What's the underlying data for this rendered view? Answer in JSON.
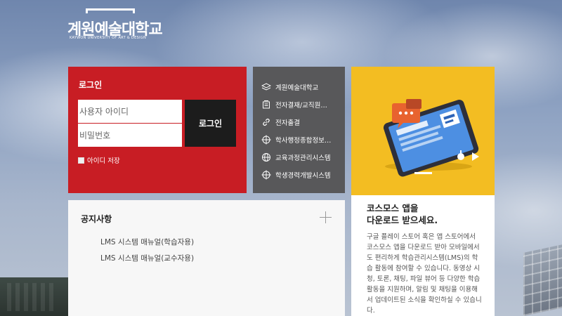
{
  "logo": {
    "name": "계원예술대학교",
    "subtitle": "KAYWON UNIVERSITY OF ART & DESIGN"
  },
  "login": {
    "title": "로그인",
    "id_placeholder": "사용자 아이디",
    "pw_placeholder": "비밀번호",
    "button_label": "로그인",
    "save_id_label": "아이디 저장"
  },
  "links": {
    "items": [
      {
        "label": "계원예술대학교",
        "icon": "layers-icon"
      },
      {
        "label": "전자결재/교직원…",
        "icon": "document-icon"
      },
      {
        "label": "전자출결",
        "icon": "link-icon"
      },
      {
        "label": "학사행정종합정보…",
        "icon": "crosshair-icon"
      },
      {
        "label": "교육과정관리시스템",
        "icon": "globe-icon"
      },
      {
        "label": "학생경력개발시스템",
        "icon": "crosshair-icon"
      }
    ]
  },
  "notice": {
    "title": "공지사항",
    "items": [
      {
        "label": "LMS 시스템 매뉴얼(학습자용)"
      },
      {
        "label": "LMS 시스템 매뉴얼(교수자용)"
      }
    ]
  },
  "app": {
    "title": "코스모스 앱을\n다운로드 받으세요.",
    "description": "구글 플레이 스토어 혹은 앱 스토어에서 코스모스 앱을 다운로드 받아 모바일에서도 편리하게 학습관리시스템(LMS)의 학습 활동에 참여할 수 있습니다. 동영상 시청, 토론, 채팅, 파일 뷰어 등 다양한 학습활동을 지원하며, 알림 및 채팅을 이용해서 업데이트된 소식을 확인하실 수 있습니다."
  },
  "colors": {
    "login_bg": "#c81d24",
    "links_bg": "#58585a",
    "app_bg": "#f3bd22"
  }
}
